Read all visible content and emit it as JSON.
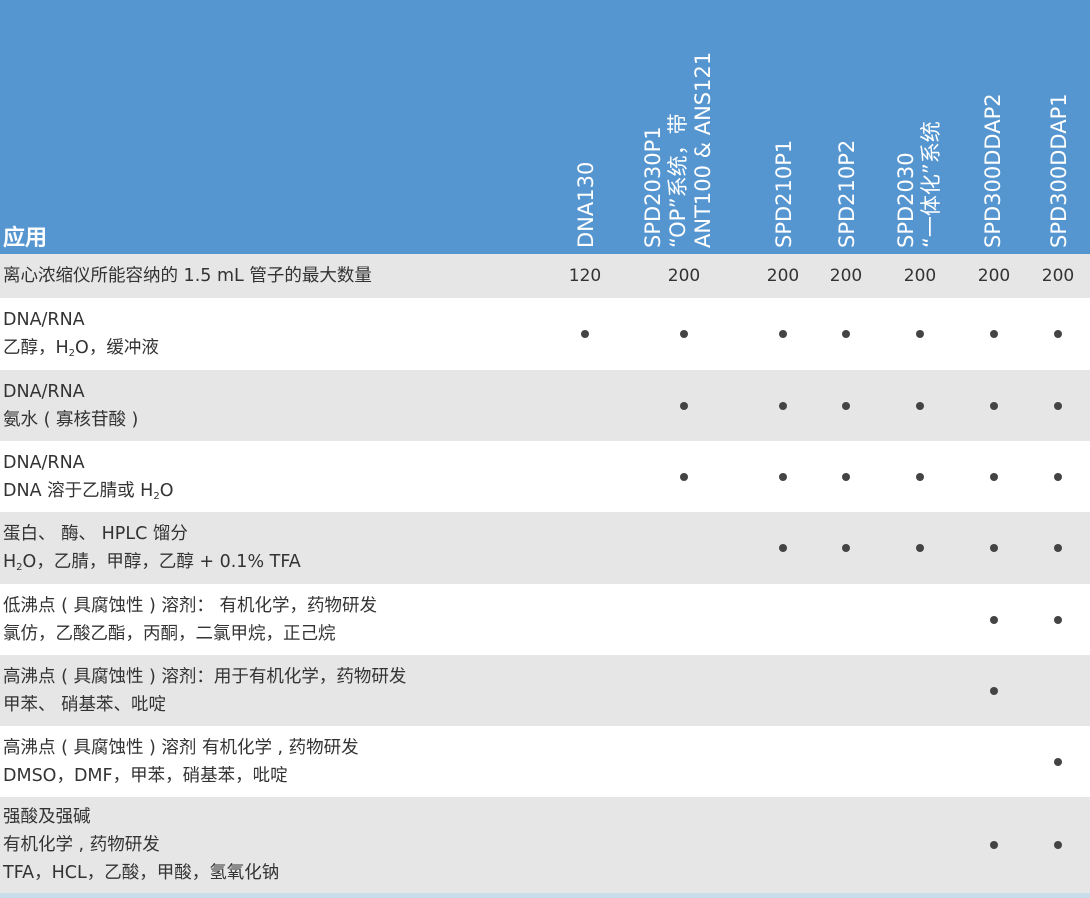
{
  "header": {
    "label": "应用",
    "columns": [
      {
        "lines": [
          "DNA130"
        ]
      },
      {
        "lines": [
          "SPD2030P1",
          "“OP”系统，带",
          "ANT100 & ANS121"
        ]
      },
      {
        "lines": [
          "SPD210P1"
        ]
      },
      {
        "lines": [
          "SPD210P2"
        ]
      },
      {
        "lines": [
          "SPD2030",
          "“一体化”系统"
        ]
      },
      {
        "lines": [
          "SPD300DDAP2"
        ]
      },
      {
        "lines": [
          "SPD300DDAP1"
        ]
      }
    ]
  },
  "rows": [
    {
      "lines": [
        "离心浓缩仪所能容纳的 1.5 mL 管子的最大数量"
      ],
      "values": [
        "120",
        "200",
        "200",
        "200",
        "200",
        "200",
        "200"
      ]
    },
    {
      "lines": [
        "DNA/RNA",
        "乙醇，H₂O，缓冲液"
      ],
      "marks": [
        true,
        true,
        true,
        true,
        true,
        true,
        true
      ]
    },
    {
      "lines": [
        "DNA/RNA",
        "氨水 ( 寡核苷酸 )"
      ],
      "marks": [
        false,
        true,
        true,
        true,
        true,
        true,
        true
      ]
    },
    {
      "lines": [
        "DNA/RNA",
        "DNA 溶于乙腈或 H₂O"
      ],
      "marks": [
        false,
        true,
        true,
        true,
        true,
        true,
        true
      ]
    },
    {
      "lines": [
        "蛋白、 酶、 HPLC 馏分",
        "H₂O，乙腈，甲醇，乙醇 + 0.1% TFA"
      ],
      "marks": [
        false,
        false,
        true,
        true,
        true,
        true,
        true
      ]
    },
    {
      "lines": [
        "低沸点 ( 具腐蚀性 ) 溶剂： 有机化学，药物研发",
        "氯仿，乙酸乙酯，丙酮，二氯甲烷，正己烷"
      ],
      "marks": [
        false,
        false,
        false,
        false,
        false,
        true,
        true
      ]
    },
    {
      "lines": [
        "高沸点 ( 具腐蚀性 ) 溶剂：用于有机化学，药物研发",
        "甲苯、 硝基苯、吡啶"
      ],
      "marks": [
        false,
        false,
        false,
        false,
        false,
        true,
        false
      ]
    },
    {
      "lines": [
        "高沸点 ( 具腐蚀性 ) 溶剂 有机化学 , 药物研发",
        "DMSO，DMF，甲苯，硝基苯，吡啶"
      ],
      "marks": [
        false,
        false,
        false,
        false,
        false,
        false,
        true
      ]
    },
    {
      "lines": [
        "强酸及强碱",
        "有机化学 , 药物研发",
        "TFA，HCL，乙酸，甲酸，氢氧化钠"
      ],
      "marks": [
        false,
        false,
        false,
        false,
        false,
        true,
        true
      ]
    }
  ],
  "colors": {
    "header_bg": "#5596d1",
    "row_shade": "#e6e6e6",
    "text": "#333333",
    "dot": "#444444"
  }
}
